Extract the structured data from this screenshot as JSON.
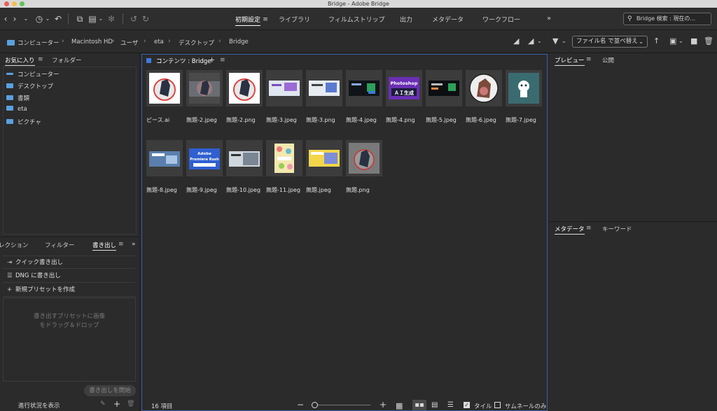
{
  "window": {
    "title": "Bridge - Adobe Bridge"
  },
  "workspaces": [
    "初期設定",
    "ライブラリ",
    "フィルムストリップ",
    "出力",
    "メタデータ",
    "ワークフロー"
  ],
  "search": {
    "placeholder": "Bridge 検索 : 現在の..."
  },
  "breadcrumb": [
    "コンピューター",
    "Macintosh HD",
    "ユーザ",
    "eta",
    "デスクトップ",
    "Bridge"
  ],
  "sort": {
    "label": "ファイル名 で並べ替え"
  },
  "left_top": {
    "tabs": [
      "お気に入り",
      "フォルダー"
    ],
    "favorites": [
      "コンピューター",
      "デスクトップ",
      "書類",
      "eta",
      "ピクチャ"
    ]
  },
  "left_bottom": {
    "tabs": [
      "レクション",
      "フィルター",
      "書き出し"
    ],
    "rows": [
      "クイック書き出し",
      "DNG に書き出し",
      "新規プリセットを作成"
    ],
    "drop_text": [
      "書き出すプリセットに画像",
      "をドラッグ＆ドロップ"
    ],
    "start_button": "書き出しを開始",
    "progress_label": "進行状況を表示"
  },
  "content": {
    "header": "コンテンツ : Bridge",
    "files": [
      {
        "name": "ピース.ai",
        "icon": "horse-mascot-icon"
      },
      {
        "name": "無題-2.jpeg",
        "icon": "horse-mascot-icon"
      },
      {
        "name": "無題-2.png",
        "icon": "horse-mascot-icon"
      },
      {
        "name": "無題-3.jpeg",
        "icon": "banner-thumbnail"
      },
      {
        "name": "無題-3.png",
        "icon": "banner-thumbnail"
      },
      {
        "name": "無題-4.jpeg",
        "icon": "banner-thumbnail"
      },
      {
        "name": "無題-4.png",
        "icon": "photoshop-banner-thumbnail",
        "caption": [
          "Photoshop",
          "ＡＩ生成"
        ]
      },
      {
        "name": "無題-5.jpeg",
        "icon": "banner-thumbnail"
      },
      {
        "name": "無題-6.jpeg",
        "icon": "horse-mascot-icon"
      },
      {
        "name": "無題-7.jpeg",
        "icon": "mascot-thumbnail"
      },
      {
        "name": "無題-8.jpeg",
        "icon": "banner-thumbnail"
      },
      {
        "name": "無題-9.jpeg",
        "icon": "premiere-banner-thumbnail",
        "caption": [
          "Adobe",
          "Premiere Rush"
        ]
      },
      {
        "name": "無題-10.jpeg",
        "icon": "banner-thumbnail"
      },
      {
        "name": "無題-11.jpeg",
        "icon": "colorful-thumbnail"
      },
      {
        "name": "無題.jpeg",
        "icon": "banner-thumbnail"
      },
      {
        "name": "無題.png",
        "icon": "horse-mascot-icon"
      }
    ],
    "item_count": "16 項目",
    "tile_label": "タイル",
    "thumb_only_label": "サムネールのみ"
  },
  "right_top": {
    "tabs": [
      "プレビュー",
      "公開"
    ]
  },
  "right_bottom": {
    "tabs": [
      "メタデータ",
      "キーワード"
    ]
  },
  "colors": {
    "accent": "#3a5ea8",
    "folder": "#5aa0e0"
  }
}
